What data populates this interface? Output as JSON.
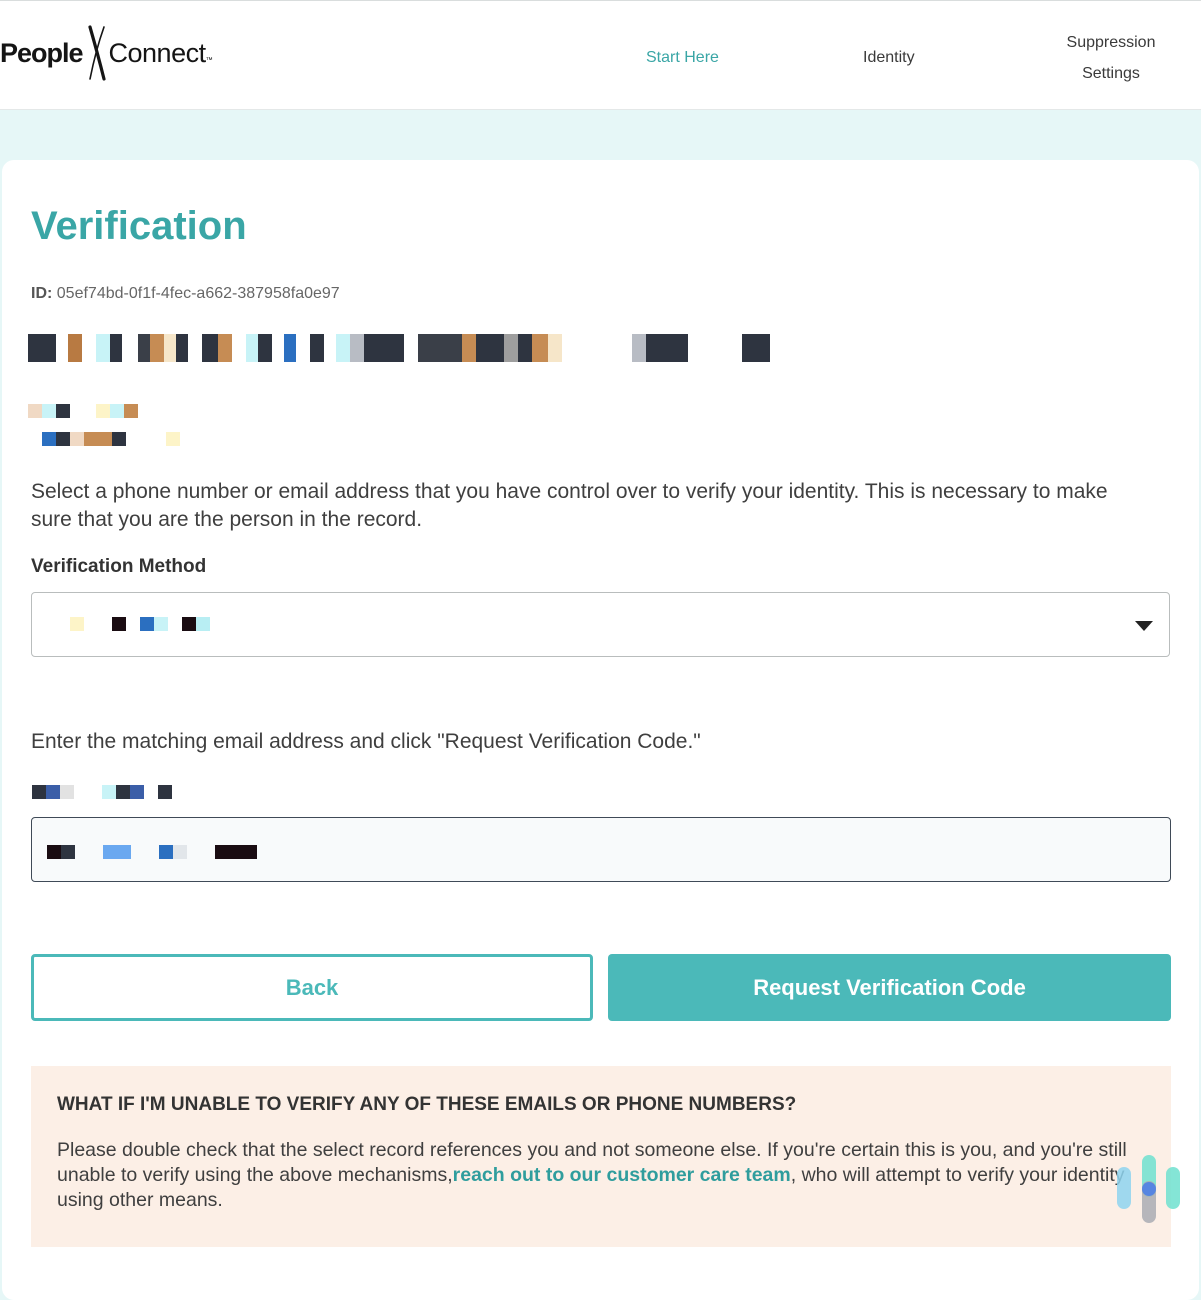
{
  "brand": {
    "part1": "People",
    "part2": "Connect",
    "tm": "™"
  },
  "nav": {
    "start_here": "Start Here",
    "identity": "Identity",
    "suppression_settings": "Suppression Settings"
  },
  "page": {
    "title": "Verification",
    "id_label": "ID:",
    "id_value": "05ef74bd-0f1f-4fec-a662-387958fa0e97",
    "instructions": "Select a phone number or email address that you have control over to verify your identity. This is necessary to make sure that you are the person in the record.",
    "verification_method_label": "Verification Method",
    "email_instruction": "Enter the matching email address and click \"Request Verification Code.\""
  },
  "buttons": {
    "back": "Back",
    "request": "Request Verification Code"
  },
  "help": {
    "heading": "WHAT IF I'M UNABLE TO VERIFY ANY OF THESE EMAILS OR PHONE NUMBERS?",
    "text_before": "Please double check that the select record references you and not someone else. If you're certain this is you, and you're still unable to verify using the above mechanisms,",
    "link_text": "reach out to our customer care team",
    "text_after": ", who will attempt to verify your identity using other means."
  },
  "icons": {
    "dropdown": "caret-down-icon",
    "chat_widget": "chat-widget-icon"
  },
  "colors": {
    "accent": "#3aa6a6",
    "button_teal": "#4bb9b9",
    "help_background": "#fcefe6",
    "page_background": "#e6f7f7"
  }
}
